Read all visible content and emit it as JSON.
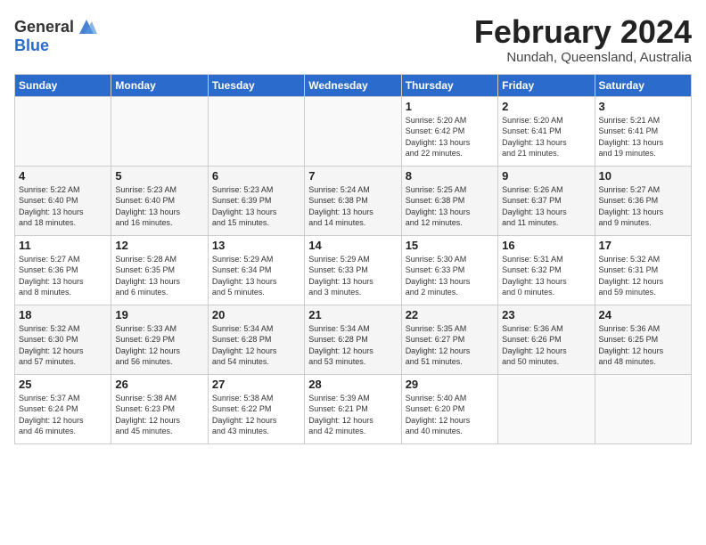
{
  "logo": {
    "general": "General",
    "blue": "Blue"
  },
  "title": "February 2024",
  "subtitle": "Nundah, Queensland, Australia",
  "headers": [
    "Sunday",
    "Monday",
    "Tuesday",
    "Wednesday",
    "Thursday",
    "Friday",
    "Saturday"
  ],
  "weeks": [
    [
      {
        "day": "",
        "info": ""
      },
      {
        "day": "",
        "info": ""
      },
      {
        "day": "",
        "info": ""
      },
      {
        "day": "",
        "info": ""
      },
      {
        "day": "1",
        "info": "Sunrise: 5:20 AM\nSunset: 6:42 PM\nDaylight: 13 hours\nand 22 minutes."
      },
      {
        "day": "2",
        "info": "Sunrise: 5:20 AM\nSunset: 6:41 PM\nDaylight: 13 hours\nand 21 minutes."
      },
      {
        "day": "3",
        "info": "Sunrise: 5:21 AM\nSunset: 6:41 PM\nDaylight: 13 hours\nand 19 minutes."
      }
    ],
    [
      {
        "day": "4",
        "info": "Sunrise: 5:22 AM\nSunset: 6:40 PM\nDaylight: 13 hours\nand 18 minutes."
      },
      {
        "day": "5",
        "info": "Sunrise: 5:23 AM\nSunset: 6:40 PM\nDaylight: 13 hours\nand 16 minutes."
      },
      {
        "day": "6",
        "info": "Sunrise: 5:23 AM\nSunset: 6:39 PM\nDaylight: 13 hours\nand 15 minutes."
      },
      {
        "day": "7",
        "info": "Sunrise: 5:24 AM\nSunset: 6:38 PM\nDaylight: 13 hours\nand 14 minutes."
      },
      {
        "day": "8",
        "info": "Sunrise: 5:25 AM\nSunset: 6:38 PM\nDaylight: 13 hours\nand 12 minutes."
      },
      {
        "day": "9",
        "info": "Sunrise: 5:26 AM\nSunset: 6:37 PM\nDaylight: 13 hours\nand 11 minutes."
      },
      {
        "day": "10",
        "info": "Sunrise: 5:27 AM\nSunset: 6:36 PM\nDaylight: 13 hours\nand 9 minutes."
      }
    ],
    [
      {
        "day": "11",
        "info": "Sunrise: 5:27 AM\nSunset: 6:36 PM\nDaylight: 13 hours\nand 8 minutes."
      },
      {
        "day": "12",
        "info": "Sunrise: 5:28 AM\nSunset: 6:35 PM\nDaylight: 13 hours\nand 6 minutes."
      },
      {
        "day": "13",
        "info": "Sunrise: 5:29 AM\nSunset: 6:34 PM\nDaylight: 13 hours\nand 5 minutes."
      },
      {
        "day": "14",
        "info": "Sunrise: 5:29 AM\nSunset: 6:33 PM\nDaylight: 13 hours\nand 3 minutes."
      },
      {
        "day": "15",
        "info": "Sunrise: 5:30 AM\nSunset: 6:33 PM\nDaylight: 13 hours\nand 2 minutes."
      },
      {
        "day": "16",
        "info": "Sunrise: 5:31 AM\nSunset: 6:32 PM\nDaylight: 13 hours\nand 0 minutes."
      },
      {
        "day": "17",
        "info": "Sunrise: 5:32 AM\nSunset: 6:31 PM\nDaylight: 12 hours\nand 59 minutes."
      }
    ],
    [
      {
        "day": "18",
        "info": "Sunrise: 5:32 AM\nSunset: 6:30 PM\nDaylight: 12 hours\nand 57 minutes."
      },
      {
        "day": "19",
        "info": "Sunrise: 5:33 AM\nSunset: 6:29 PM\nDaylight: 12 hours\nand 56 minutes."
      },
      {
        "day": "20",
        "info": "Sunrise: 5:34 AM\nSunset: 6:28 PM\nDaylight: 12 hours\nand 54 minutes."
      },
      {
        "day": "21",
        "info": "Sunrise: 5:34 AM\nSunset: 6:28 PM\nDaylight: 12 hours\nand 53 minutes."
      },
      {
        "day": "22",
        "info": "Sunrise: 5:35 AM\nSunset: 6:27 PM\nDaylight: 12 hours\nand 51 minutes."
      },
      {
        "day": "23",
        "info": "Sunrise: 5:36 AM\nSunset: 6:26 PM\nDaylight: 12 hours\nand 50 minutes."
      },
      {
        "day": "24",
        "info": "Sunrise: 5:36 AM\nSunset: 6:25 PM\nDaylight: 12 hours\nand 48 minutes."
      }
    ],
    [
      {
        "day": "25",
        "info": "Sunrise: 5:37 AM\nSunset: 6:24 PM\nDaylight: 12 hours\nand 46 minutes."
      },
      {
        "day": "26",
        "info": "Sunrise: 5:38 AM\nSunset: 6:23 PM\nDaylight: 12 hours\nand 45 minutes."
      },
      {
        "day": "27",
        "info": "Sunrise: 5:38 AM\nSunset: 6:22 PM\nDaylight: 12 hours\nand 43 minutes."
      },
      {
        "day": "28",
        "info": "Sunrise: 5:39 AM\nSunset: 6:21 PM\nDaylight: 12 hours\nand 42 minutes."
      },
      {
        "day": "29",
        "info": "Sunrise: 5:40 AM\nSunset: 6:20 PM\nDaylight: 12 hours\nand 40 minutes."
      },
      {
        "day": "",
        "info": ""
      },
      {
        "day": "",
        "info": ""
      }
    ]
  ]
}
